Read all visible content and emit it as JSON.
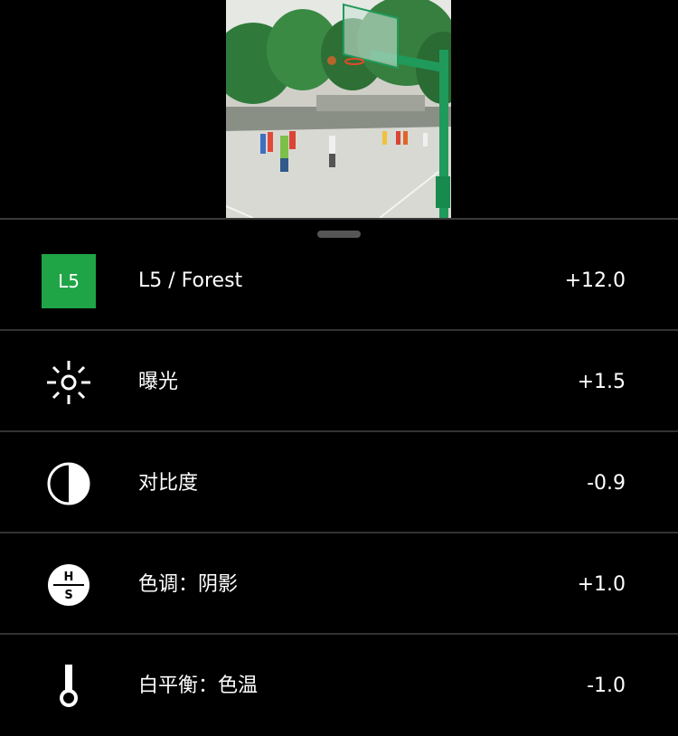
{
  "colors": {
    "background": "#000000",
    "preset_badge": "#1fa446",
    "divider": "#333333"
  },
  "preview": {
    "image": "basketball-court-photo"
  },
  "adjustments": [
    {
      "icon": "preset-badge",
      "badge_text": "L5",
      "label": "L5 / Forest",
      "value": "+12.0"
    },
    {
      "icon": "exposure-icon",
      "label": "曝光",
      "value": "+1.5"
    },
    {
      "icon": "contrast-icon",
      "label": "对比度",
      "value": "-0.9"
    },
    {
      "icon": "hs-tone-icon",
      "label": "色调：阴影",
      "value": "+1.0",
      "icon_text_top": "H",
      "icon_text_bottom": "S"
    },
    {
      "icon": "thermometer-icon",
      "label": "白平衡：色温",
      "value": "-1.0"
    }
  ]
}
